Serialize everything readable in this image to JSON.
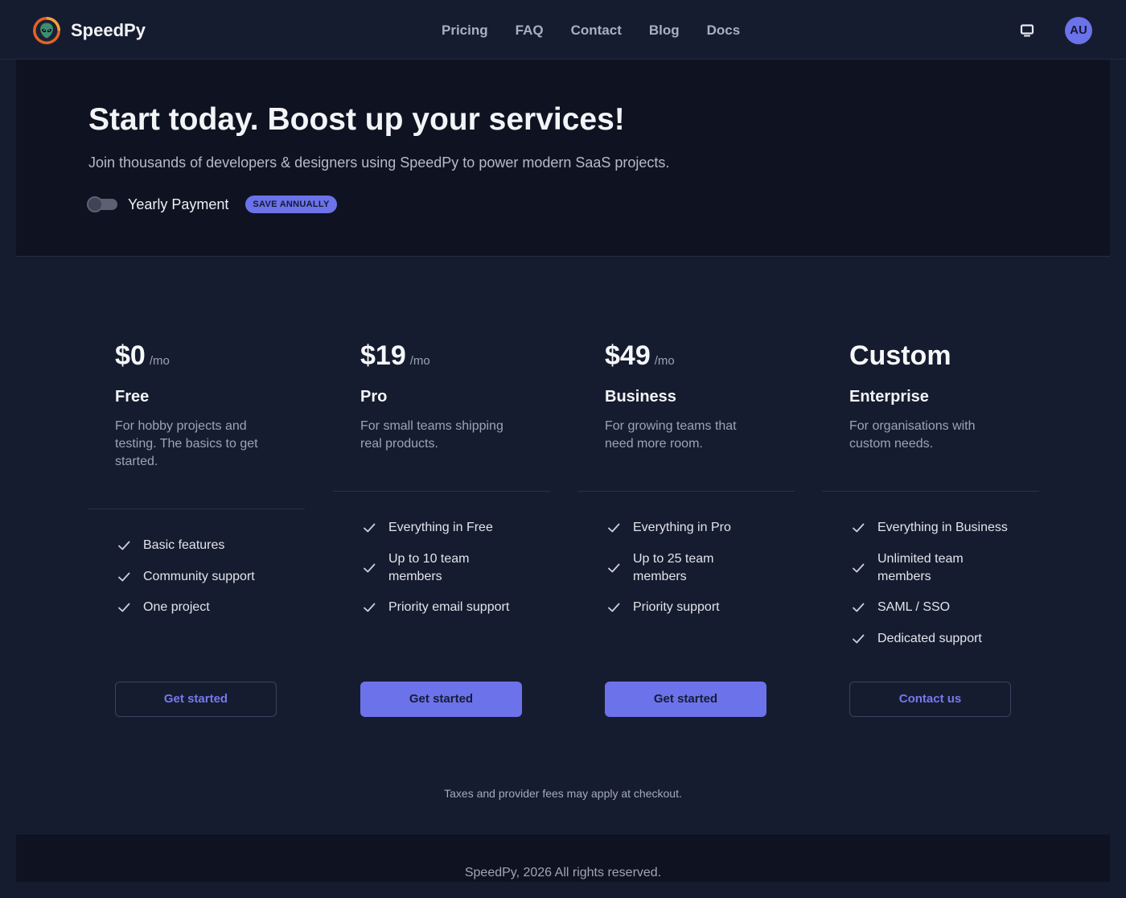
{
  "brand": {
    "name": "SpeedPy",
    "logo_icon": "alien-logo-icon"
  },
  "nav": {
    "links": [
      "Pricing",
      "FAQ",
      "Contact",
      "Blog",
      "Docs"
    ]
  },
  "header_actions": {
    "theme_icon": "monitor-icon",
    "avatar_initials": "AU"
  },
  "hero": {
    "title": "Start today. Boost up your services!",
    "subtitle": "Join thousands of developers & designers using SpeedPy to power modern SaaS projects.",
    "billing_toggle": {
      "label": "Yearly Payment",
      "checked": false
    },
    "badge": "SAVE ANNUALLY"
  },
  "feature_icon": "check-icon",
  "plans": [
    {
      "price": "$0",
      "period": "/mo",
      "name": "Free",
      "description": "For hobby projects and testing. The basics to get started.",
      "features": [
        "Basic features",
        "Community support",
        "One project"
      ],
      "cta": "Get started"
    },
    {
      "price": "$19",
      "period": "/mo",
      "name": "Pro",
      "description": "For small teams shipping real products.",
      "features": [
        "Everything in Free",
        "Up to 10 team members",
        "Priority email support"
      ],
      "cta": "Get started"
    },
    {
      "price": "$49",
      "period": "/mo",
      "name": "Business",
      "description": "For growing teams that need more room.",
      "features": [
        "Everything in Pro",
        "Up to 25 team members",
        "Priority support"
      ],
      "cta": "Get started"
    },
    {
      "price": "Custom",
      "period": "",
      "name": "Enterprise",
      "description": "For organisations with custom needs.",
      "features": [
        "Everything in Business",
        "Unlimited team members",
        "SAML / SSO",
        "Dedicated support"
      ],
      "cta": "Contact us"
    }
  ],
  "footnote": "Taxes and provider fees may apply at checkout.",
  "footer": {
    "copyright": "SpeedPy, 2026 All rights reserved."
  },
  "colors": {
    "page_bg": "#161c2f",
    "hero_bg": "#0f1321",
    "accent": "#6c72ea",
    "text_primary": "#f3f4f7",
    "text_muted": "#9ba3b5"
  }
}
